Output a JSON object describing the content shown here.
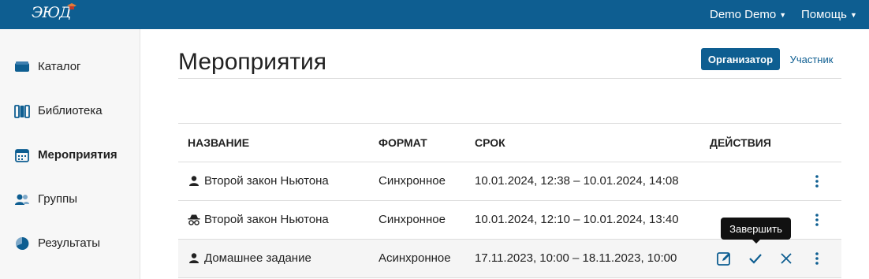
{
  "header": {
    "logo_text": "ЭЮД",
    "user_menu": "Demo Demo",
    "help_menu": "Помощь"
  },
  "sidebar": {
    "items": [
      {
        "label": "Каталог",
        "icon": "catalog-icon"
      },
      {
        "label": "Библиотека",
        "icon": "library-icon"
      },
      {
        "label": "Мероприятия",
        "icon": "calendar-icon",
        "active": true
      },
      {
        "label": "Группы",
        "icon": "users-icon"
      },
      {
        "label": "Результаты",
        "icon": "pie-chart-icon"
      }
    ]
  },
  "main": {
    "title": "Мероприятия",
    "roles": {
      "organizer": "Организатор",
      "participant": "Участник",
      "selected": "Организатор"
    },
    "columns": [
      "НАЗВАНИЕ",
      "ФОРМАТ",
      "СРОК",
      "ДЕЙСТВИЯ"
    ],
    "rows": [
      {
        "icon": "user-icon",
        "name": "Второй закон Ньютона",
        "format": "Синхронное",
        "period": "10.01.2024, 12:38 – 10.01.2024, 14:08"
      },
      {
        "icon": "incognito-icon",
        "name": "Второй закон Ньютона",
        "format": "Синхронное",
        "period": "10.01.2024, 12:10 – 10.01.2024, 13:40"
      },
      {
        "icon": "user-icon",
        "name": "Домашнее задание",
        "format": "Асинхронное",
        "period": "17.11.2023, 10:00 – 18.11.2023, 10:00"
      }
    ],
    "tooltip": "Завершить"
  },
  "colors": {
    "brand": "#0e5e91",
    "sidebar_bg": "#f7f7f7",
    "row_highlight": "#f5f5f5"
  }
}
